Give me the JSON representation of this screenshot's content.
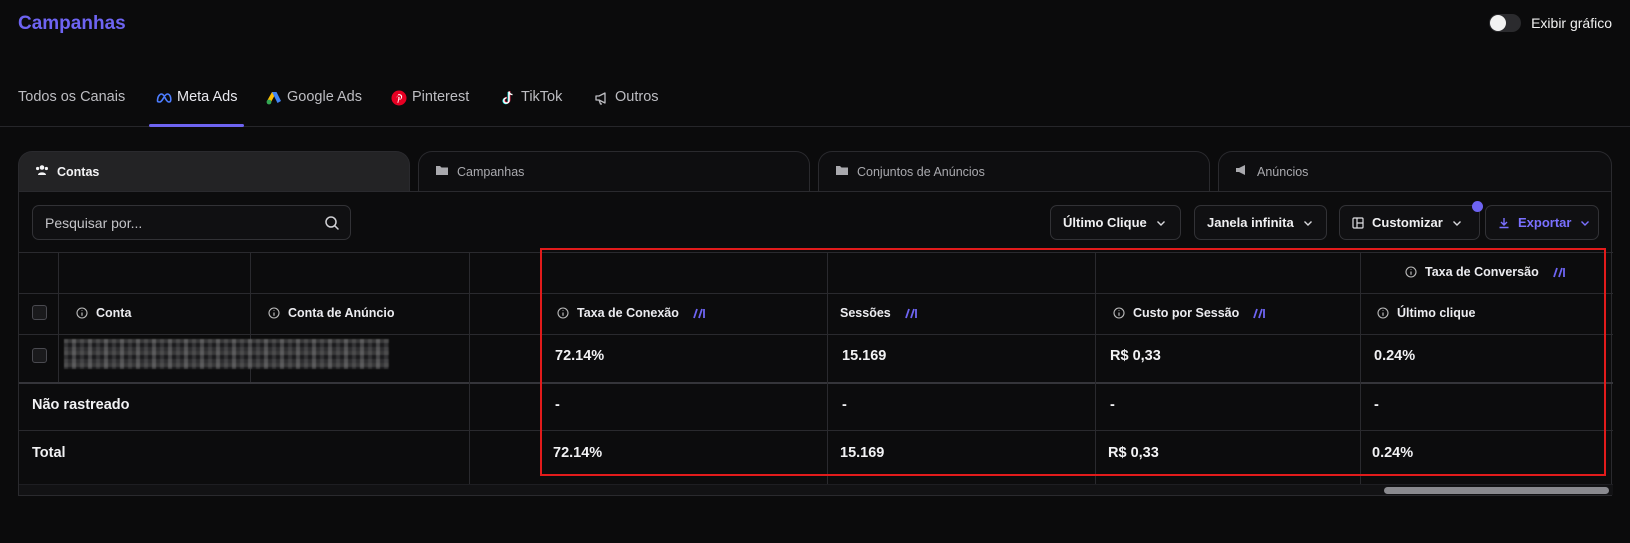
{
  "header": {
    "title": "Campanhas",
    "toggle_label": "Exibir gráfico",
    "toggle_on": false
  },
  "channels": [
    {
      "label": "Todos os Canais",
      "icon": "none"
    },
    {
      "label": "Meta Ads",
      "icon": "meta-icon",
      "active": true
    },
    {
      "label": "Google Ads",
      "icon": "google-ads-icon"
    },
    {
      "label": "Pinterest",
      "icon": "pinterest-icon"
    },
    {
      "label": "TikTok",
      "icon": "tiktok-icon"
    },
    {
      "label": "Outros",
      "icon": "megaphone-icon"
    }
  ],
  "levels": [
    {
      "label": "Contas",
      "icon": "users-icon",
      "active": true
    },
    {
      "label": "Campanhas",
      "icon": "folder-icon"
    },
    {
      "label": "Conjuntos de Anúncios",
      "icon": "folder-icon"
    },
    {
      "label": "Anúncios",
      "icon": "megaphone-icon"
    }
  ],
  "toolbar": {
    "search_placeholder": "Pesquisar por...",
    "attribution": "Último Clique",
    "window": "Janela infinita",
    "customize": "Customizar",
    "export": "Exportar"
  },
  "table": {
    "group_header": "Taxa de Conversão",
    "columns": [
      "Conta",
      "Conta de Anúncio",
      "",
      "Taxa de Conexão",
      "Sessões",
      "Custo por Sessão",
      "Último clique"
    ],
    "rows": [
      {
        "label": "",
        "values": [
          "72.14%",
          "15.169",
          "R$ 0,33",
          "0.24%"
        ]
      },
      {
        "label": "Não rastreado",
        "values": [
          "-",
          "-",
          "-",
          "-"
        ]
      },
      {
        "label": "Total",
        "values": [
          "72.14%",
          "15.169",
          "R$ 0,33",
          "0.24%"
        ]
      }
    ]
  },
  "colors": {
    "accent": "#6e64f2",
    "highlight": "#e21b1b",
    "background": "#0b0b0c"
  }
}
